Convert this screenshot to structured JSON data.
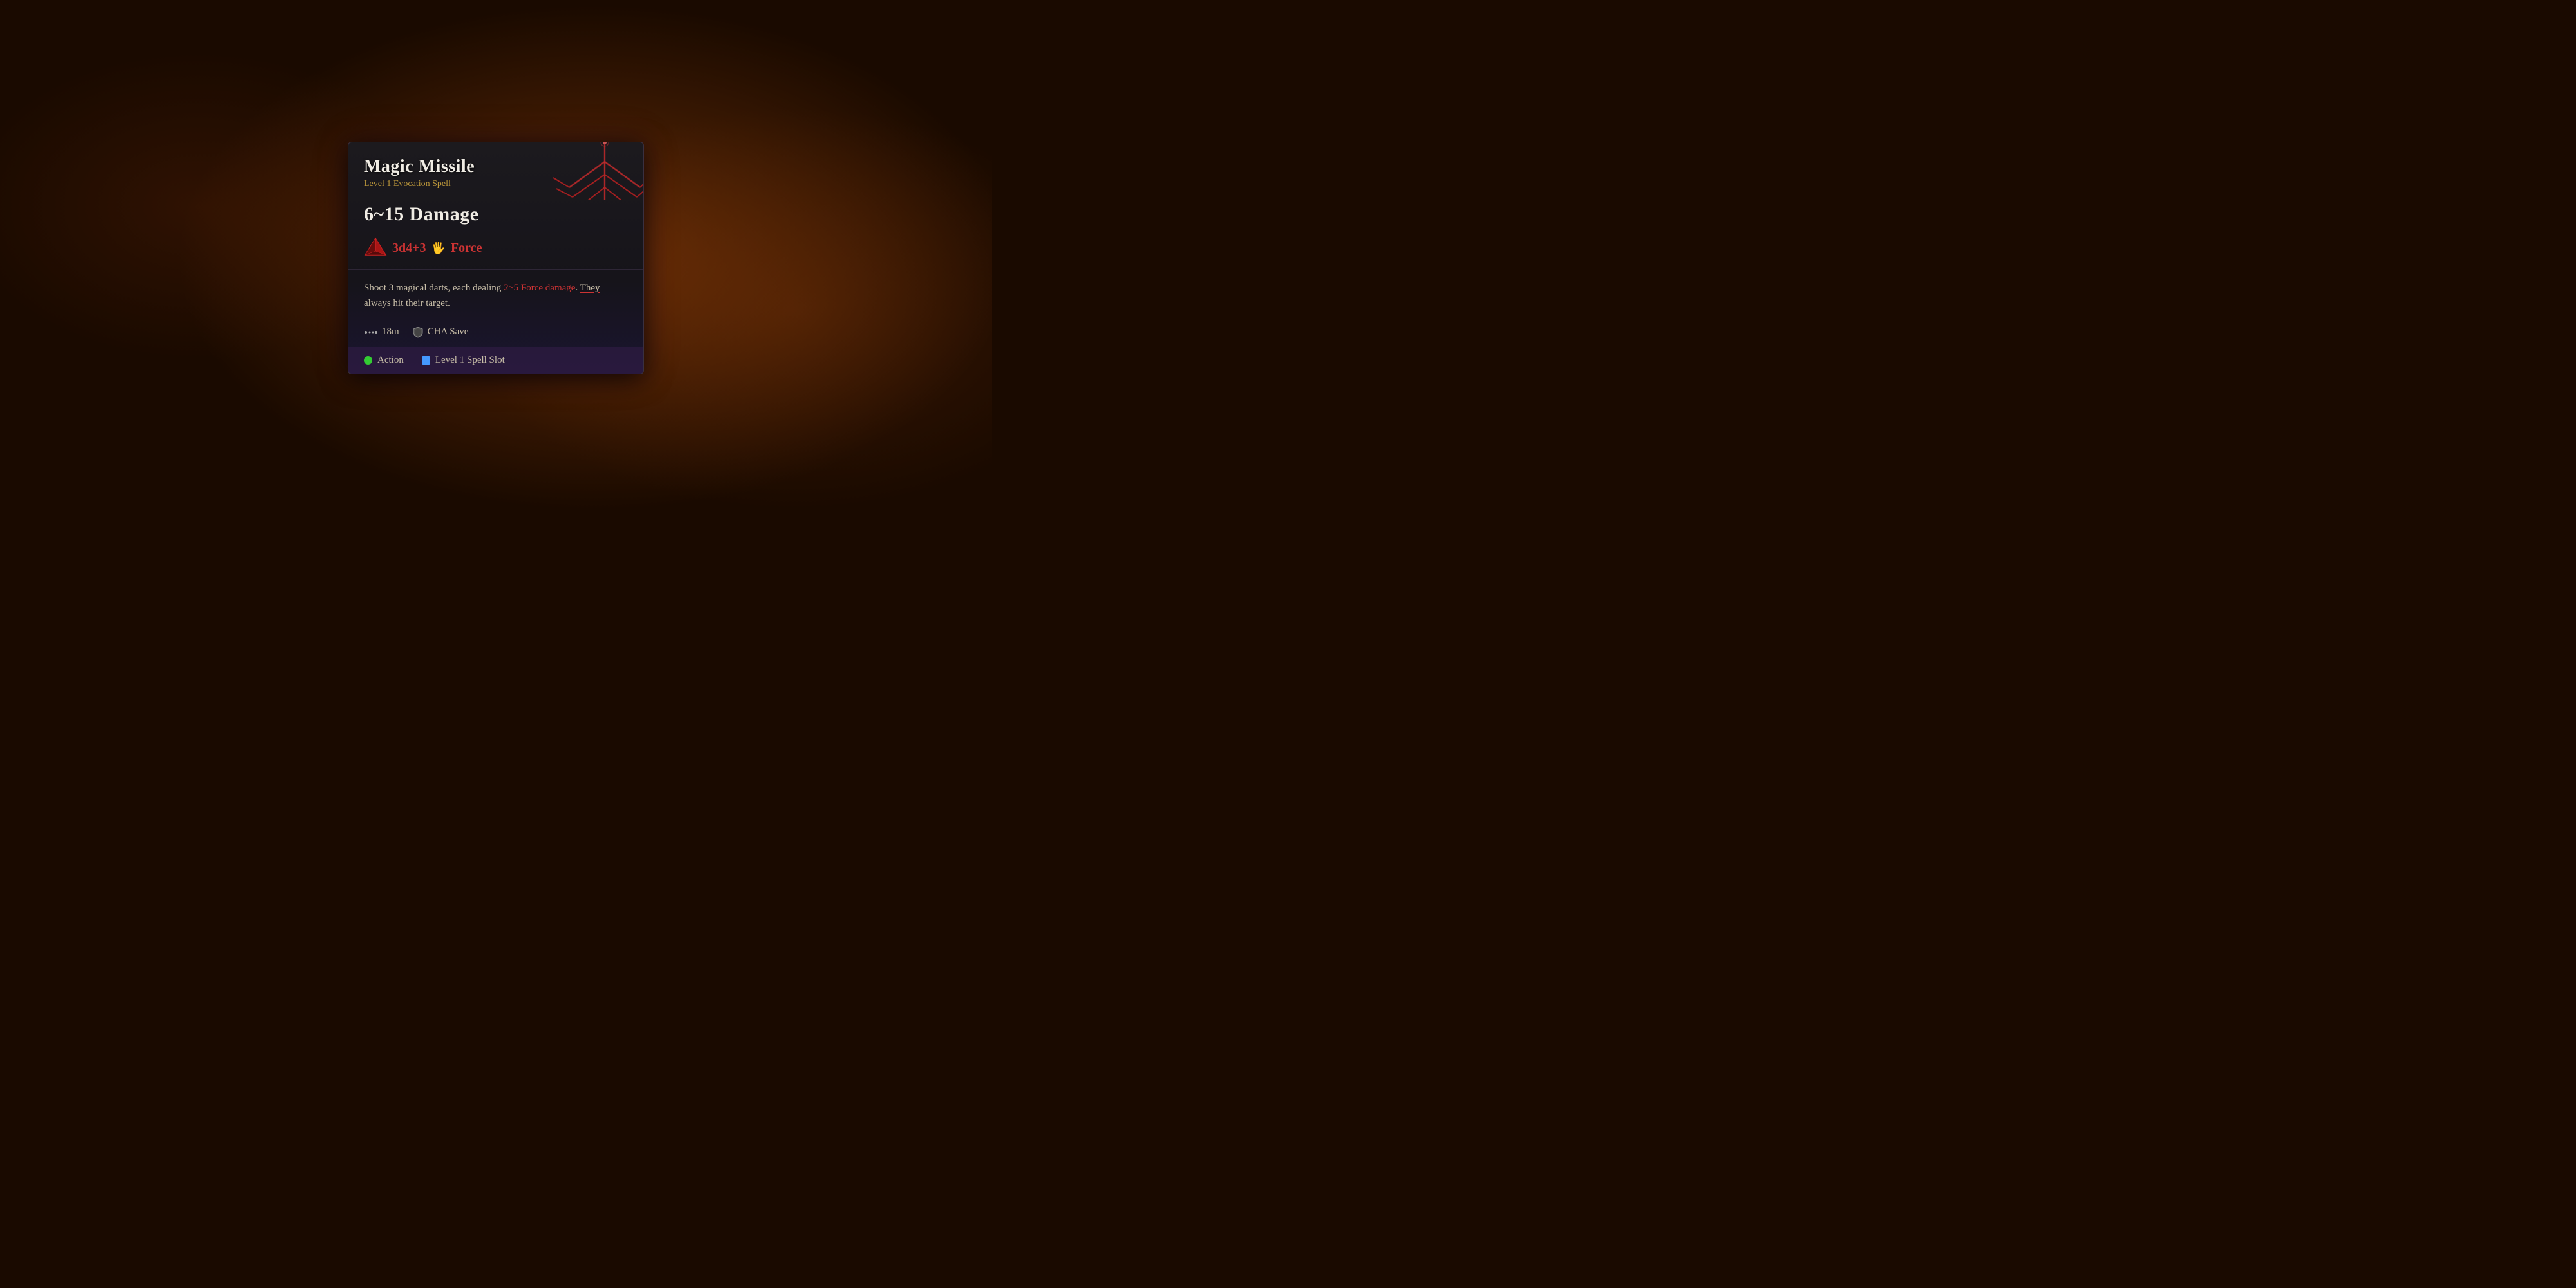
{
  "background": {
    "color": "#1a0a00"
  },
  "tooltip": {
    "spell_name": "Magic Missile",
    "spell_subtitle": "Level 1 Evocation Spell",
    "damage_value": "6~15 Damage",
    "dice_formula": "3d4+3",
    "force_label": "Force",
    "description_plain_start": "Shoot 3 magical darts, each dealing ",
    "description_highlight": "2~5 Force damage",
    "description_middle": ". ",
    "description_underline_they": "They",
    "description_plain_end": " always hit their target.",
    "range_value": "18m",
    "save_label": "CHA Save",
    "action_label": "Action",
    "spell_slot_label": "Level 1 Spell Slot"
  }
}
